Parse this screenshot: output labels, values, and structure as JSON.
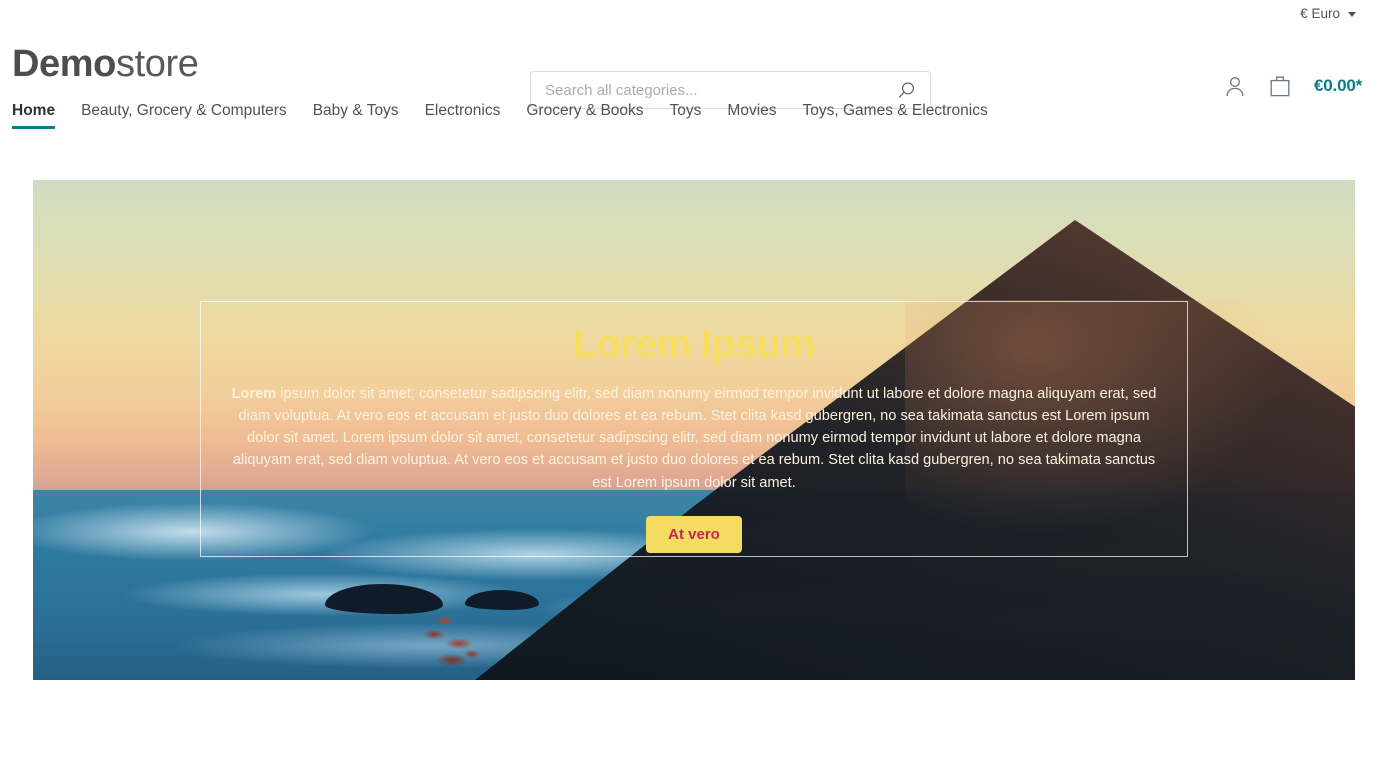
{
  "topbar": {
    "currency_label": "€ Euro",
    "caret_icon": "chevron-down-icon"
  },
  "header": {
    "logo_strong": "Demo",
    "logo_light": "store",
    "search": {
      "placeholder": "Search all categories...",
      "value": "",
      "icon": "search-icon"
    },
    "account_icon": "user-icon",
    "cart_icon": "shopping-bag-icon",
    "cart_total": "€0.00*"
  },
  "nav": {
    "items": [
      {
        "label": "Home",
        "active": true
      },
      {
        "label": "Beauty, Grocery & Computers",
        "active": false
      },
      {
        "label": "Baby & Toys",
        "active": false
      },
      {
        "label": "Electronics",
        "active": false
      },
      {
        "label": "Grocery & Books",
        "active": false
      },
      {
        "label": "Toys",
        "active": false
      },
      {
        "label": "Movies",
        "active": false
      },
      {
        "label": "Toys, Games & Electronics",
        "active": false
      }
    ]
  },
  "hero": {
    "title": "Lorem Ipsum",
    "text_lead": "Lorem",
    "text_body": " ipsum dolor sit amet, consetetur sadipscing elitr, sed diam nonumy eirmod tempor invidunt ut labore et dolore magna aliquyam erat, sed diam voluptua. At vero eos et accusam et justo duo dolores et ea rebum. Stet clita kasd gubergren, no sea takimata sanctus est Lorem ipsum dolor sit amet. Lorem ipsum dolor sit amet, consetetur sadipscing elitr, sed diam nonumy eirmod tempor invidunt ut labore et dolore magna aliquyam erat, sed diam voluptua. At vero eos et accusam et justo duo dolores et ea rebum. Stet clita kasd gubergren, no sea takimata sanctus est Lorem ipsum dolor sit amet.",
    "button_label": "At vero"
  },
  "colors": {
    "accent_teal": "#0b7c8c",
    "hero_title_yellow": "#f6dd5e",
    "button_bg": "#f4dc62",
    "button_text": "#c8274e",
    "text_default": "#4a545b"
  }
}
